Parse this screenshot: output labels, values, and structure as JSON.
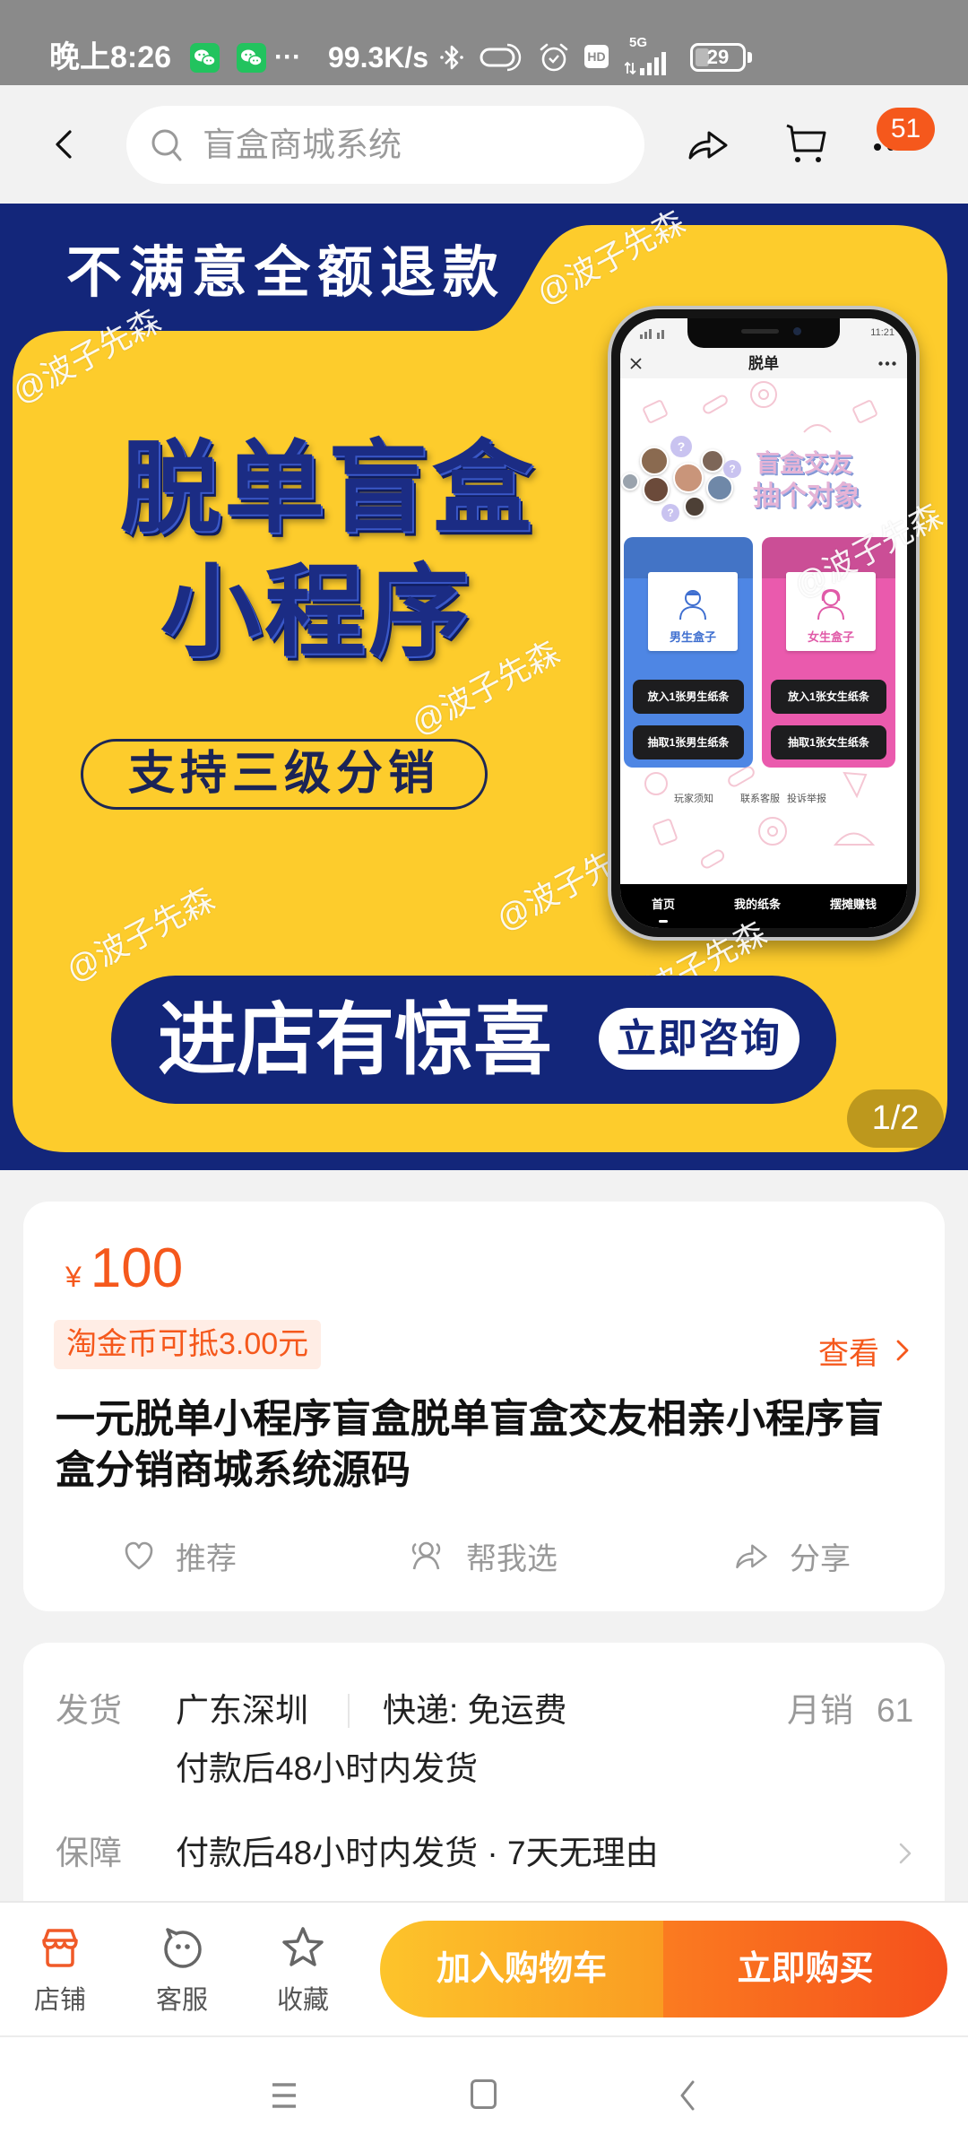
{
  "status_bar": {
    "time": "晚上8:26",
    "more_notifications": "···",
    "net_speed": "99.3K/s",
    "hd_label": "HD",
    "network": "5G",
    "battery": "29",
    "battery_percent": 29
  },
  "nav": {
    "search_placeholder": "盲盒商城系统",
    "badge_count": "51"
  },
  "banner": {
    "top_slogan": "不满意全额退款",
    "headline_1": "脱单盲盒",
    "headline_2": "小程序",
    "feature_pill": "支持三级分销",
    "cta_text": "进店有惊喜",
    "cta_button": "立即咨询",
    "watermark": "@波子先森",
    "page_indicator": "1/2",
    "phone": {
      "status_time": "11:21",
      "title": "脱单",
      "unknown_marker": "?",
      "slogan_1": "盲盒交友",
      "slogan_2": "抽个对象",
      "boxes": [
        {
          "label": "男生盒子",
          "put": "放入1张男生纸条",
          "draw": "抽取1张男生纸条"
        },
        {
          "label": "女生盒子",
          "put": "放入1张女生纸条",
          "draw": "抽取1张女生纸条"
        }
      ],
      "links": [
        "玩家须知",
        "联系客服",
        "投诉举报"
      ],
      "tabs": [
        "首页",
        "我的纸条",
        "摆摊赚钱"
      ]
    }
  },
  "product": {
    "currency": "¥",
    "price": "100",
    "coin_offer": "淘金币可抵3.00元",
    "view_label": "查看",
    "title": "一元脱单小程序盲盒脱单盲盒交友相亲小程序盲盒分销商城系统源码",
    "actions": [
      {
        "icon": "heart-icon",
        "label": "推荐"
      },
      {
        "icon": "people-icon",
        "label": "帮我选"
      },
      {
        "icon": "share-icon",
        "label": "分享"
      }
    ]
  },
  "shipping": {
    "ship_label": "发货",
    "origin": "广东深圳",
    "express": "快递: 免运费",
    "monthly_sales_label": "月销",
    "monthly_sales": "61",
    "ship_time": "付款后48小时内发货",
    "guarantee_label": "保障",
    "guarantees": "付款后48小时内发货 · 7天无理由"
  },
  "bottom_bar": {
    "items": [
      {
        "icon": "store-icon",
        "label": "店铺"
      },
      {
        "icon": "customer-service-icon",
        "label": "客服"
      },
      {
        "icon": "star-icon",
        "label": "收藏"
      }
    ],
    "add_to_cart": "加入购物车",
    "buy_now": "立即购买"
  },
  "colors": {
    "accent": "#f5581c",
    "navy": "#13267a",
    "yellow": "#fdcc2c",
    "cart_start": "#fdc42b",
    "cart_end": "#fa9c22",
    "buy_start": "#fb7b20",
    "buy_end": "#f5501c"
  }
}
